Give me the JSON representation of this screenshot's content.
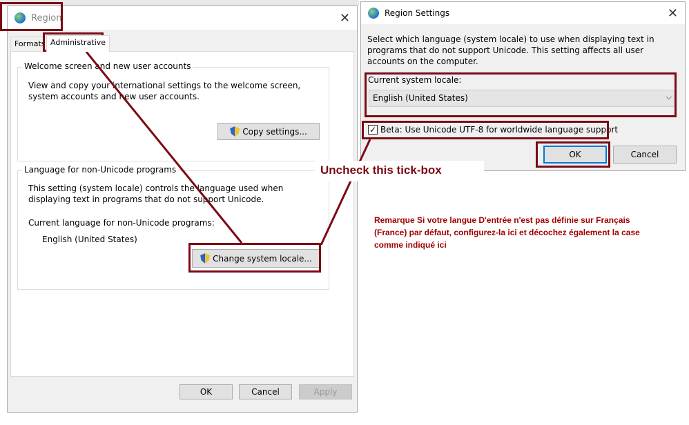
{
  "region_window": {
    "title": "Region",
    "close_icon": "close-icon",
    "tabs": [
      {
        "label": "Formats"
      },
      {
        "label": "Administrative",
        "selected": true
      }
    ],
    "welcome_group": {
      "legend": "Welcome screen and new user accounts",
      "description": "View and copy your international settings to the welcome screen, system accounts and new user accounts.",
      "copy_button": "Copy settings..."
    },
    "language_group": {
      "legend": "Language for non-Unicode programs",
      "description": "This setting (system locale) controls the language used when displaying text in programs that do not support Unicode.",
      "current_label": "Current language for non-Unicode programs:",
      "current_value": "English (United States)",
      "change_button": "Change system locale..."
    },
    "buttons": {
      "ok": "OK",
      "cancel": "Cancel",
      "apply": "Apply"
    }
  },
  "settings_dialog": {
    "title": "Region Settings",
    "description": "Select which language (system locale) to use when displaying text in programs that do not support Unicode. This setting affects all user accounts on the computer.",
    "locale_label": "Current system locale:",
    "locale_value": "English (United States)",
    "beta_checkbox": {
      "label": "Beta: Use Unicode UTF-8 for worldwide language support",
      "checked": true
    },
    "buttons": {
      "ok": "OK",
      "cancel": "Cancel"
    }
  },
  "annotations": {
    "callout": "Uncheck this tick-box",
    "note": "Remarque Si votre langue D'entrée n'est pas définie sur Français (France) par défaut, configurez-la ici et décochez également la case comme indiqué ici",
    "color": "#7b0a14"
  }
}
